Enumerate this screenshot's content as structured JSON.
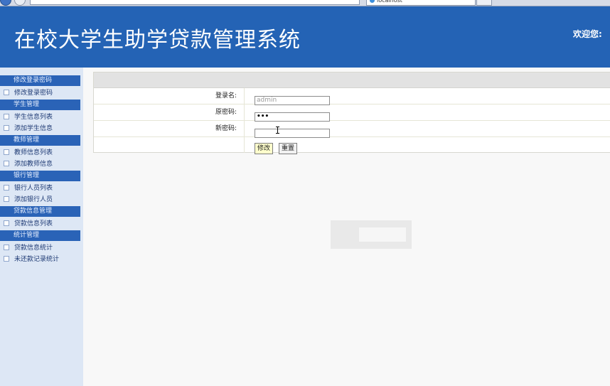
{
  "browser": {
    "tab_title": "localhost"
  },
  "header": {
    "title": "在校大学生助学贷款管理系统",
    "welcome": "欢迎您:"
  },
  "sidebar": {
    "sections": [
      {
        "title": "修改登录密码",
        "items": [
          "修改登录密码"
        ]
      },
      {
        "title": "学生管理",
        "items": [
          "学生信息列表",
          "添加学生信息"
        ]
      },
      {
        "title": "教师管理",
        "items": [
          "教师信息列表",
          "添加教师信息"
        ]
      },
      {
        "title": "银行管理",
        "items": [
          "银行人员列表",
          "添加银行人员"
        ]
      },
      {
        "title": "贷款信息管理",
        "items": [
          "贷款信息列表"
        ]
      },
      {
        "title": "统计管理",
        "items": [
          "贷款信息统计",
          "未还款记录统计"
        ]
      }
    ]
  },
  "form": {
    "username_label": "登录名:",
    "username_value": "admin",
    "old_password_label": "原密码:",
    "old_password_value": "•••",
    "new_password_label": "新密码:",
    "new_password_value": "",
    "submit_label": "修改",
    "reset_label": "重置"
  },
  "colors": {
    "header_bg": "#2463b5",
    "sidebar_bg": "#dde7f5",
    "section_bg": "#2a63b7",
    "submit_bg": "#ffffcc"
  }
}
